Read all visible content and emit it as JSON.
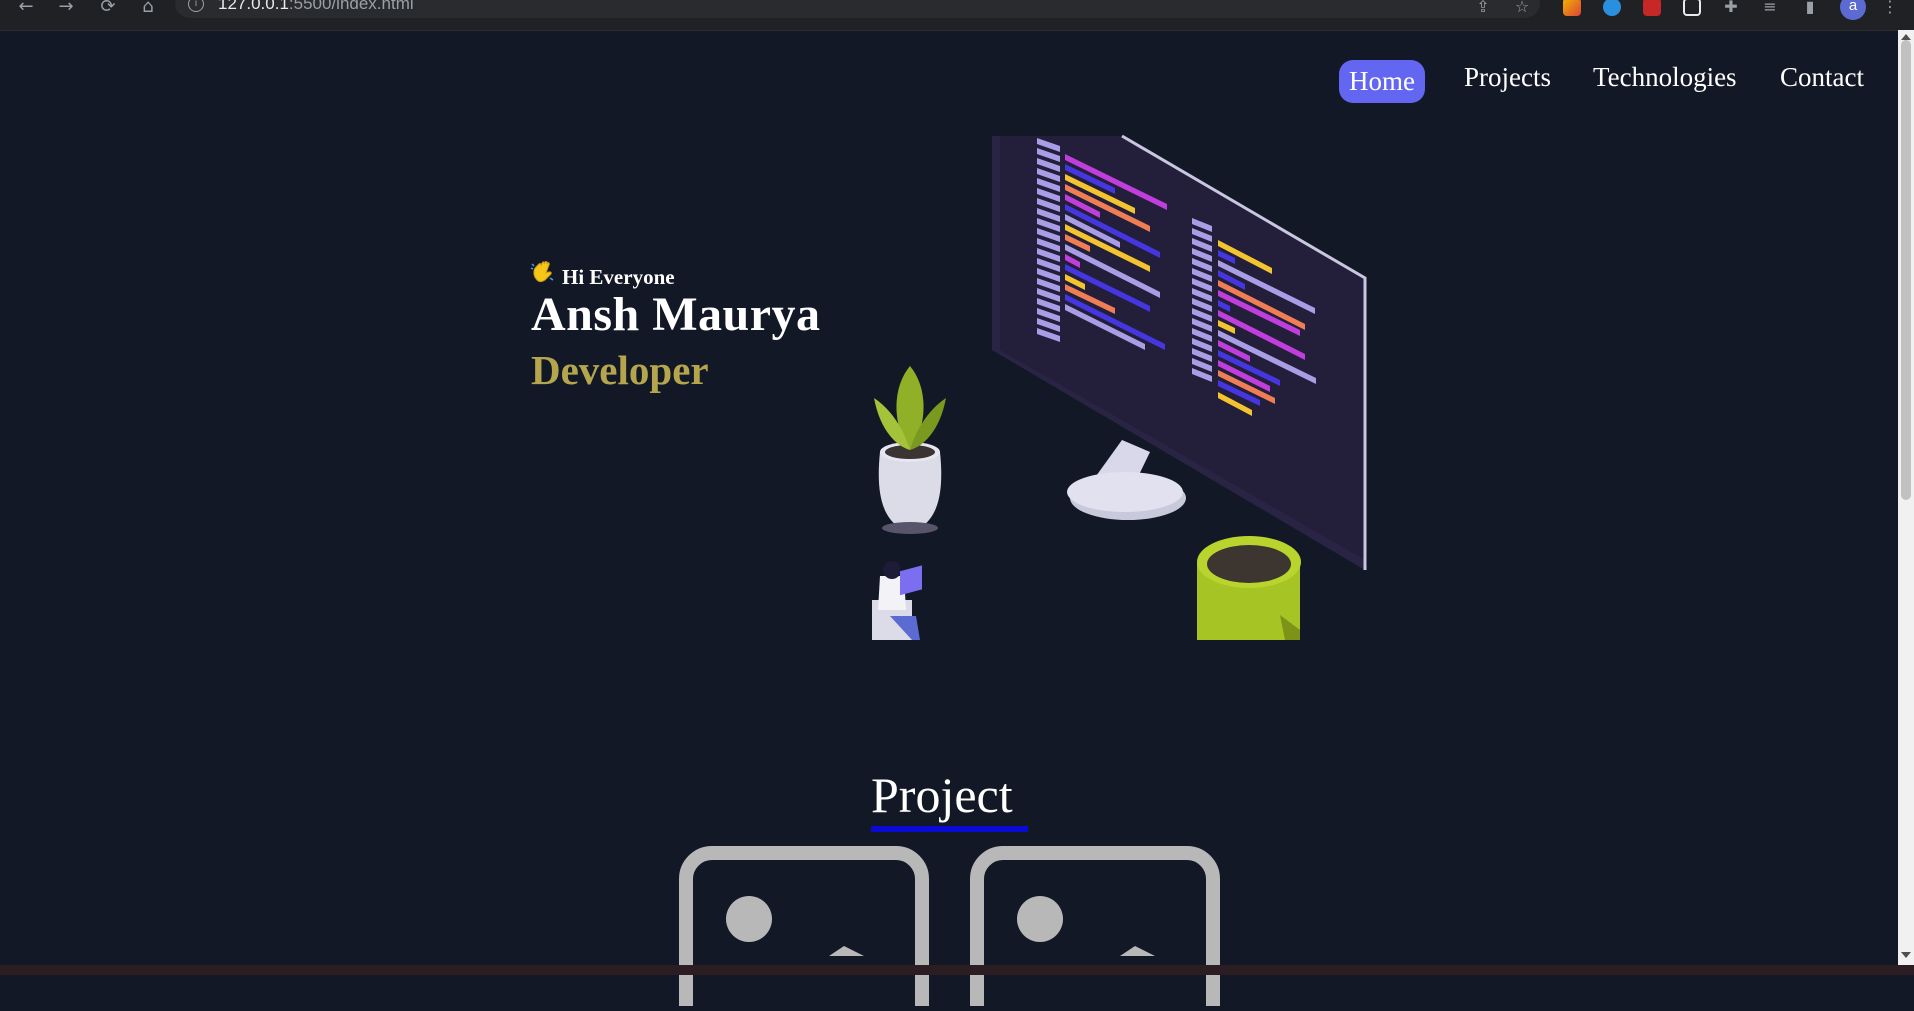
{
  "browser": {
    "url_host": "127.0.0.1",
    "url_rest": ":5500/index.html",
    "avatar_letter": "a"
  },
  "nav": {
    "items": [
      "Home",
      "Projects",
      "Technologies",
      "Contact"
    ],
    "active": "Home",
    "active_color": "#6366f1"
  },
  "hero": {
    "greeting": "Hi Everyone",
    "greeting_icon": "waving-hand-icon",
    "name": "Ansh Maurya",
    "role": "Developer",
    "role_color": "#b5a64e"
  },
  "projects": {
    "title": "Project",
    "underline_color": "#0a0ad6",
    "card_icon": "image-placeholder-icon"
  },
  "colors": {
    "background": "#121826"
  }
}
